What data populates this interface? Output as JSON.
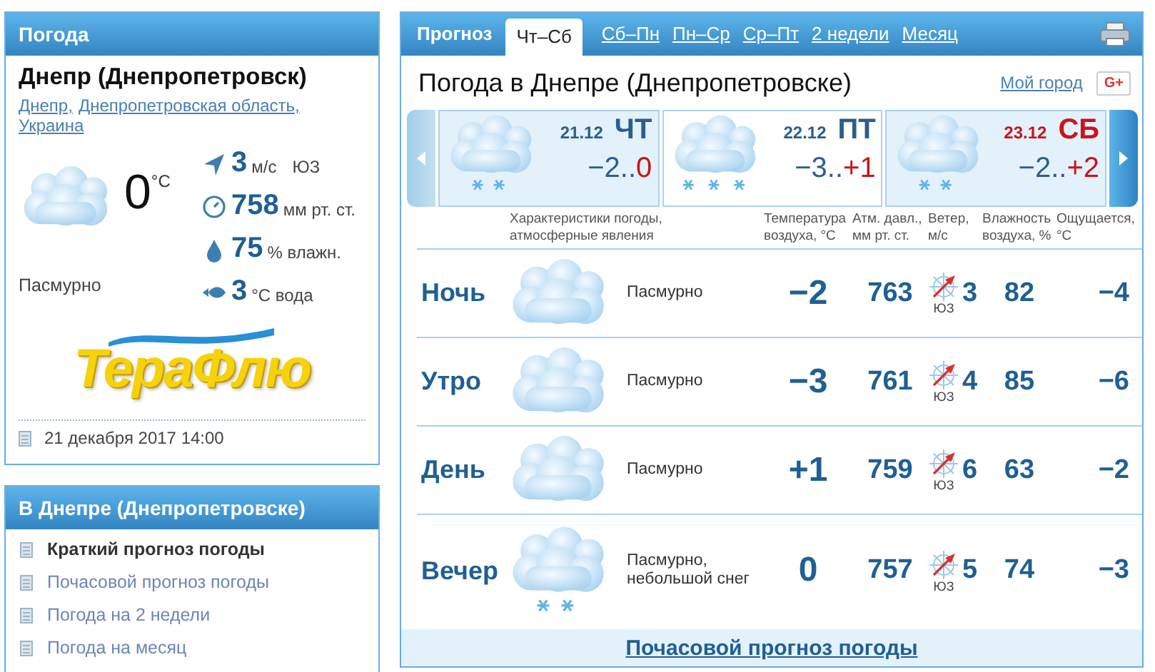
{
  "now_panel": {
    "title": "Погода",
    "city": "Днепр (Днепропетровск)",
    "location_links": [
      "Днепр,",
      "Днепропетровская область,",
      "Украина"
    ],
    "temperature": "0",
    "temperature_unit": "°C",
    "condition": "Пасмурно",
    "stats": [
      {
        "kind": "wind",
        "value": "3",
        "unit": "м/с",
        "extra": "ЮЗ"
      },
      {
        "kind": "pressure",
        "value": "758",
        "unit": "мм рт. ст."
      },
      {
        "kind": "humidity",
        "value": "75",
        "unit": "% влажн."
      },
      {
        "kind": "water",
        "value": "3",
        "unit": "°C вода"
      }
    ],
    "ad_logo": "ТераФлю",
    "updated": "21 декабря 2017 14:00"
  },
  "links_panel": {
    "title": "В Днепре (Днепропетровске)",
    "items": [
      {
        "label": "Краткий прогноз погоды",
        "selected": true
      },
      {
        "label": "Почасовой прогноз погоды",
        "selected": false
      },
      {
        "label": "Погода на 2 недели",
        "selected": false
      },
      {
        "label": "Погода на месяц",
        "selected": false
      }
    ]
  },
  "forecast": {
    "heading": "Прогноз",
    "tabs": [
      {
        "label": "Чт–Сб",
        "selected": true
      },
      {
        "label": "Сб–Пн",
        "selected": false
      },
      {
        "label": "Пн–Ср",
        "selected": false
      },
      {
        "label": "Ср–Пт",
        "selected": false
      },
      {
        "label": "2 недели",
        "selected": false
      },
      {
        "label": "Месяц",
        "selected": false
      }
    ],
    "title": "Погода в Днепре (Днепропетровске)",
    "my_city": "Мой город",
    "share": "G+",
    "days": [
      {
        "date": "21.12",
        "weekday": "ЧТ",
        "low": "−2..",
        "high": "0",
        "weekend": false,
        "selected": false,
        "kind": "light_snow"
      },
      {
        "date": "22.12",
        "weekday": "ПТ",
        "low": "−3..",
        "high": "+1",
        "weekend": false,
        "selected": true,
        "kind": "snow"
      },
      {
        "date": "23.12",
        "weekday": "СБ",
        "low": "−2..",
        "high": "+2",
        "weekend": true,
        "selected": false,
        "kind": "light_snow"
      }
    ],
    "columns": [
      "Характеристики погоды, атмосферные явления",
      "Температура воздуха, °C",
      "Атм. давл., мм рт. ст.",
      "Ветер, м/с",
      "Влажность воздуха, %",
      "Ощущается, °C"
    ],
    "rows": [
      {
        "period": "Ночь",
        "kind": "overcast",
        "condition": "Пасмурно",
        "temperature": "−2",
        "pressure": "763",
        "wind": "3",
        "wind_dir": "ЮЗ",
        "humidity": "82",
        "feels": "−4"
      },
      {
        "period": "Утро",
        "kind": "overcast",
        "condition": "Пасмурно",
        "temperature": "−3",
        "pressure": "761",
        "wind": "4",
        "wind_dir": "ЮЗ",
        "humidity": "85",
        "feels": "−6"
      },
      {
        "period": "День",
        "kind": "overcast",
        "condition": "Пасмурно",
        "temperature": "+1",
        "pressure": "759",
        "wind": "6",
        "wind_dir": "ЮЗ",
        "humidity": "63",
        "feels": "−2"
      },
      {
        "period": "Вечер",
        "kind": "light_snow",
        "condition": "Пасмурно, небольшой снег",
        "temperature": "0",
        "pressure": "757",
        "wind": "5",
        "wind_dir": "ЮЗ",
        "humidity": "74",
        "feels": "−3"
      }
    ],
    "footer_link": "Почасовой прогноз погоды"
  }
}
